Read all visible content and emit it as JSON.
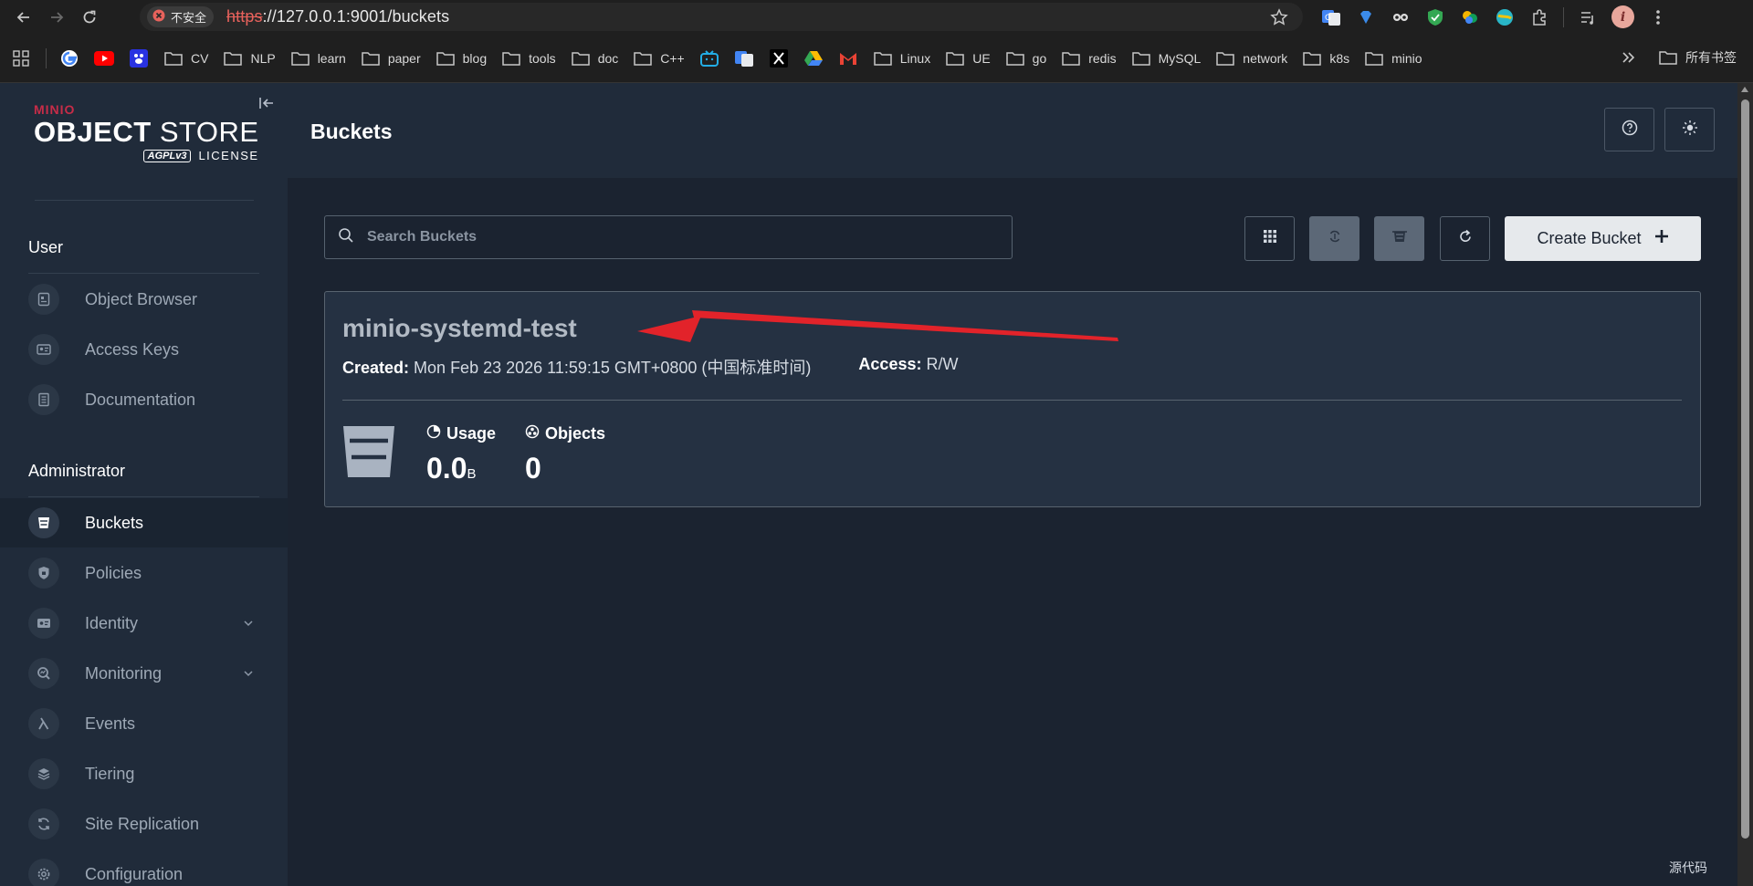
{
  "browser": {
    "security_chip": "不安全",
    "url_scheme": "https",
    "url_rest": "://127.0.0.1:9001/buckets",
    "bookmarks": [
      "CV",
      "NLP",
      "learn",
      "paper",
      "blog",
      "tools",
      "doc",
      "C++",
      "Linux",
      "UE",
      "go",
      "redis",
      "MySQL",
      "network",
      "k8s",
      "minio"
    ],
    "all_bookmarks": "所有书签",
    "profile_initial": "i"
  },
  "sidebar": {
    "logo_brand": "MINIO",
    "logo_object": "OBJECT",
    "logo_store": " STORE",
    "logo_agpl": "AGPLv3",
    "logo_license": "LICENSE",
    "user_section": "User",
    "user_items": [
      {
        "label": "Object Browser",
        "icon": "object-browser-icon"
      },
      {
        "label": "Access Keys",
        "icon": "access-keys-icon"
      },
      {
        "label": "Documentation",
        "icon": "documentation-icon"
      }
    ],
    "admin_section": "Administrator",
    "admin_items": [
      {
        "label": "Buckets",
        "icon": "bucket-icon",
        "active": true
      },
      {
        "label": "Policies",
        "icon": "policies-icon"
      },
      {
        "label": "Identity",
        "icon": "identity-icon",
        "expandable": true
      },
      {
        "label": "Monitoring",
        "icon": "monitoring-icon",
        "expandable": true
      },
      {
        "label": "Events",
        "icon": "lambda-icon"
      },
      {
        "label": "Tiering",
        "icon": "tiering-icon"
      },
      {
        "label": "Site Replication",
        "icon": "site-replication-icon"
      },
      {
        "label": "Configuration",
        "icon": "configuration-icon"
      }
    ]
  },
  "main": {
    "title": "Buckets",
    "search_placeholder": "Search Buckets",
    "create_button": "Create Bucket",
    "buckets": [
      {
        "name": "minio-systemd-test",
        "created_label": "Created:",
        "created_value": "Mon Feb 23 2026 11:59:15 GMT+0800 (中国标准时间)",
        "access_label": "Access:",
        "access_value": "R/W",
        "usage_label": "Usage",
        "usage_value": "0.0",
        "usage_unit": "B",
        "objects_label": "Objects",
        "objects_value": "0"
      }
    ]
  },
  "status_hint": "源代码",
  "colors": {
    "accent_red": "#e2232a",
    "brand_red": "#c72c48",
    "sidebar_bg": "#202b3a",
    "main_bg": "#1b2330"
  }
}
